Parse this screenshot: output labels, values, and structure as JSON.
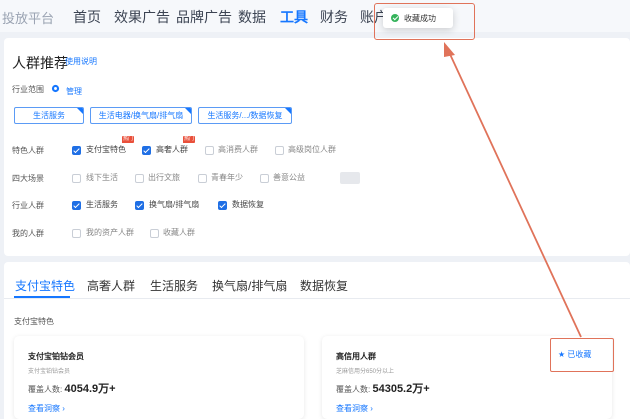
{
  "topnav": {
    "brand": "投放平台",
    "items": [
      "首页",
      "效果广告",
      "品牌广告",
      "数据",
      "工具",
      "财务",
      "账户"
    ],
    "active_index": 4
  },
  "recommend": {
    "title": "人群推荐",
    "help_link": "使用说明",
    "industry_label": "行业范围",
    "manage_link": "管理",
    "tags": [
      "生活服务",
      "生活电器/换气扇/排气扇",
      "生活服务/.../数据恢复"
    ],
    "rows": [
      {
        "label": "特色人群",
        "options": [
          {
            "label": "支付宝特色",
            "checked": true,
            "hot": true
          },
          {
            "label": "高奢人群",
            "checked": true,
            "hot": true
          },
          {
            "label": "高消费人群",
            "checked": false,
            "hot": false
          },
          {
            "label": "高级岗位人群",
            "checked": false,
            "hot": false
          }
        ]
      },
      {
        "label": "四大场景",
        "options": [
          {
            "label": "线下生活",
            "checked": false
          },
          {
            "label": "出行文旅",
            "checked": false
          },
          {
            "label": "青春年少",
            "checked": false
          },
          {
            "label": "善意公益",
            "checked": false
          }
        ]
      },
      {
        "label": "行业人群",
        "options": [
          {
            "label": "生活服务",
            "checked": true
          },
          {
            "label": "换气扇/排气扇",
            "checked": true
          },
          {
            "label": "数据恢复",
            "checked": true
          }
        ]
      },
      {
        "label": "我的人群",
        "options": [
          {
            "label": "我的资产人群",
            "checked": false
          },
          {
            "label": "收藏人群",
            "checked": false
          }
        ]
      }
    ],
    "hot_badge": "热门"
  },
  "results": {
    "tabs": [
      "支付宝特色",
      "高奢人群",
      "生活服务",
      "换气扇/排气扇",
      "数据恢复"
    ],
    "active_tab": 0,
    "section_label": "支付宝特色",
    "cards": [
      {
        "name": "支付宝铂钻会员",
        "desc": "支付宝铂钻会员",
        "cover_label": "覆盖人数:",
        "cover_value": "4054.9万+",
        "link": "查看洞察"
      },
      {
        "name": "高信用人群",
        "desc": "芝麻信用分650分以上",
        "cover_label": "覆盖人数:",
        "cover_value": "54305.2万+",
        "link": "查看洞察"
      }
    ],
    "favorite_label": "已收藏"
  },
  "toast": {
    "message": "收藏成功"
  },
  "colors": {
    "primary": "#1677ff",
    "annotation": "#e0735a",
    "success": "#35b35b",
    "hot": "#e9503b"
  }
}
